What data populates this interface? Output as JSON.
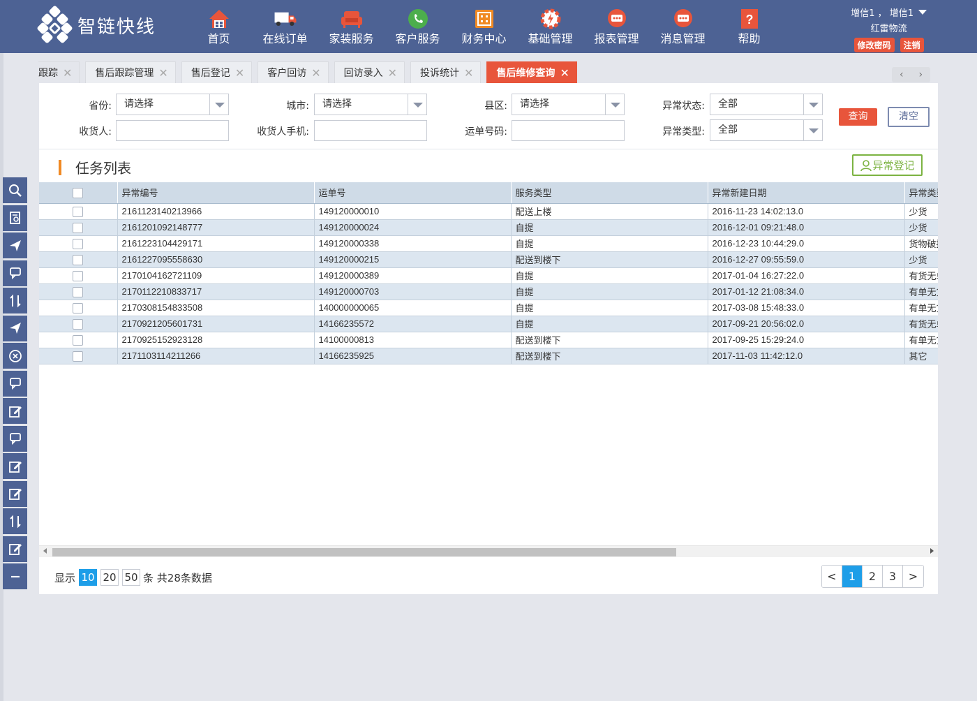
{
  "app": {
    "name": "智链快线"
  },
  "nav": [
    {
      "label": "首页",
      "icon": "home-icon",
      "color": "#e8553b"
    },
    {
      "label": "在线订单",
      "icon": "truck-icon",
      "color": "#e8553b"
    },
    {
      "label": "家装服务",
      "icon": "sofa-icon",
      "color": "#e8553b"
    },
    {
      "label": "客户服务",
      "icon": "phone-icon",
      "color": "#4cae4c"
    },
    {
      "label": "财务中心",
      "icon": "calculator-icon",
      "color": "#f08a24"
    },
    {
      "label": "基础管理",
      "icon": "gear-icon",
      "color": "#e8553b"
    },
    {
      "label": "报表管理",
      "icon": "chat-icon",
      "color": "#e8553b"
    },
    {
      "label": "消息管理",
      "icon": "message-icon",
      "color": "#e8553b"
    },
    {
      "label": "帮助",
      "icon": "help-icon",
      "color": "#e8553b"
    }
  ],
  "user": {
    "names": "增信1 ， 增信1",
    "company": "红雷物流",
    "change_password": "修改密码",
    "logout": "注销"
  },
  "tabs": [
    {
      "label": "跟踪",
      "active": false
    },
    {
      "label": "售后跟踪管理",
      "active": false
    },
    {
      "label": "售后登记",
      "active": false
    },
    {
      "label": "客户回访",
      "active": false
    },
    {
      "label": "回访录入",
      "active": false
    },
    {
      "label": "投诉统计",
      "active": false
    },
    {
      "label": "售后维修查询",
      "active": true
    }
  ],
  "tab_nav": {
    "prev": "‹",
    "next": "›"
  },
  "search": {
    "province_label": "省份:",
    "province_value": "请选择",
    "city_label": "城市:",
    "city_value": "请选择",
    "county_label": "县区:",
    "county_value": "请选择",
    "status_label": "异常状态:",
    "status_value": "全部",
    "consignee_label": "收货人:",
    "consignee_value": "",
    "phone_label": "收货人手机:",
    "phone_value": "",
    "waybill_label": "运单号码:",
    "waybill_value": "",
    "type_label": "异常类型:",
    "type_value": "全部",
    "query_button": "查询",
    "clear_button": "清空"
  },
  "list": {
    "title": "任务列表",
    "register_button": "异常登记"
  },
  "table": {
    "columns": [
      "",
      "异常编号",
      "运单号",
      "服务类型",
      "异常新建日期",
      "异常类型"
    ],
    "rows": [
      [
        "2161123140213966",
        "149120000010",
        "配送上楼",
        "2016-11-23 14:02:13.0",
        "少货"
      ],
      [
        "2161201092148777",
        "149120000024",
        "自提",
        "2016-12-01 09:21:48.0",
        "少货"
      ],
      [
        "2161223104429171",
        "149120000338",
        "自提",
        "2016-12-23 10:44:29.0",
        "货物破损"
      ],
      [
        "2161227095558630",
        "149120000215",
        "配送到楼下",
        "2016-12-27 09:55:59.0",
        "少货"
      ],
      [
        "2170104162721109",
        "149120000389",
        "自提",
        "2017-01-04 16:27:22.0",
        "有货无单"
      ],
      [
        "2170112210833717",
        "149120000703",
        "自提",
        "2017-01-12 21:08:34.0",
        "有单无货"
      ],
      [
        "2170308154833508",
        "140000000065",
        "自提",
        "2017-03-08 15:48:33.0",
        "有单无货"
      ],
      [
        "2170921205601731",
        "14166235572",
        "自提",
        "2017-09-21 20:56:02.0",
        "有货无单"
      ],
      [
        "2170925152923128",
        "14100000813",
        "配送到楼下",
        "2017-09-25 15:29:24.0",
        "有单无货"
      ],
      [
        "2171103114211266",
        "14166235925",
        "配送到楼下",
        "2017-11-03 11:42:12.0",
        "其它"
      ]
    ]
  },
  "pagination": {
    "show_label": "显示",
    "sizes": [
      "10",
      "20",
      "50"
    ],
    "active_size": "10",
    "summary": "条 共28条数据",
    "prev": "<",
    "pages": [
      "1",
      "2",
      "3"
    ],
    "current_page": "1",
    "next": ">"
  },
  "sidebar_tools": [
    "search-icon",
    "document-search-icon",
    "send-icon",
    "chat-icon",
    "swap-icon",
    "send-icon",
    "cancel-icon",
    "chat-icon",
    "edit-icon",
    "chat-icon",
    "edit-icon",
    "edit-icon",
    "swap-icon",
    "edit-icon",
    "collapse-icon"
  ],
  "colors": {
    "header": "#4d6294",
    "accent": "#e8553b",
    "primary_blue": "#1e9ee8",
    "success": "#7cb342",
    "title_bar": "#f08a24"
  }
}
